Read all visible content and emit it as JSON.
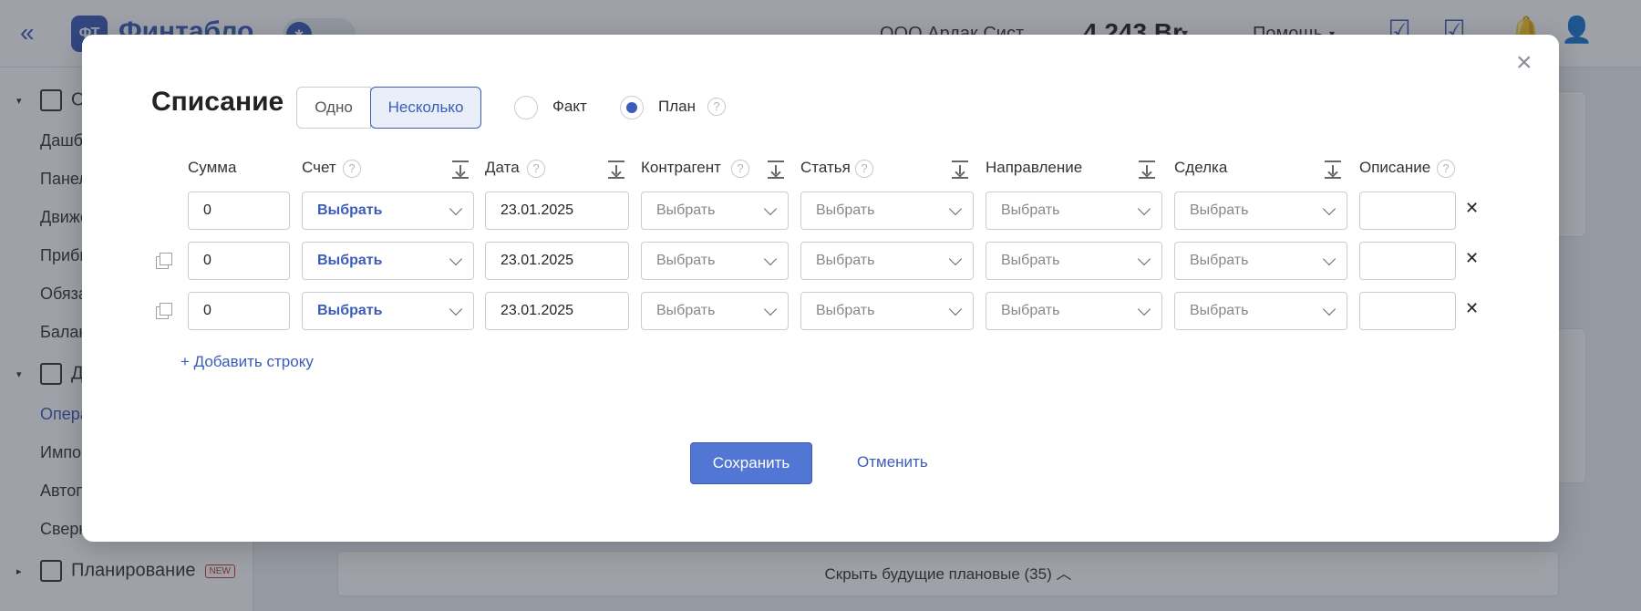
{
  "app": {
    "logo_text": "Финтабло",
    "logo_mark": "ФТ",
    "org_dot": "✱",
    "company": "ООО Ардак Сист",
    "balance": "4 243 Br",
    "help_label": "Помощь"
  },
  "sidebar": {
    "section_analytics": "Отчеты",
    "items_analytics": [
      "Дашборд",
      "Панель",
      "Движение",
      "Прибыль",
      "Обязательства",
      "Баланс"
    ],
    "section_money": "Деньги",
    "items_money": [
      "Операции",
      "Импорт",
      "Автоправила",
      "Сверка"
    ],
    "section_planning": "Планирование",
    "new_badge": "NEW"
  },
  "footer_bar": {
    "label": "Скрыть будущие плановые",
    "count": "(35)",
    "caret": "︿"
  },
  "modal": {
    "title": "Списание",
    "close_glyph": "×",
    "mode_one": "Одно",
    "mode_many": "Несколько",
    "mode_selected": "Несколько",
    "type_fact": "Факт",
    "type_plan": "План",
    "type_selected": "План",
    "help_glyph": "?",
    "columns": {
      "amount": "Сумма",
      "account": "Счет",
      "date": "Дата",
      "counterparty": "Контрагент",
      "category": "Статья",
      "direction": "Направление",
      "deal": "Сделка",
      "description": "Описание"
    },
    "rows": [
      {
        "amount": "0",
        "account": "Выбрать",
        "date": "23.01.2025",
        "counterparty": "Выбрать",
        "category": "Выбрать",
        "direction": "Выбрать",
        "deal": "Выбрать",
        "description": ""
      },
      {
        "amount": "0",
        "account": "Выбрать",
        "date": "23.01.2025",
        "counterparty": "Выбрать",
        "category": "Выбрать",
        "direction": "Выбрать",
        "deal": "Выбрать",
        "description": ""
      },
      {
        "amount": "0",
        "account": "Выбрать",
        "date": "23.01.2025",
        "counterparty": "Выбрать",
        "category": "Выбрать",
        "direction": "Выбрать",
        "deal": "Выбрать",
        "description": ""
      }
    ],
    "remove_glyph": "✕",
    "add_row": "+ Добавить строку",
    "save": "Сохранить",
    "cancel": "Отменить"
  },
  "colors": {
    "accent": "#3b5cb8",
    "save_button": "#5276d4",
    "overlay": "#282e3c"
  },
  "icons": [
    "double-chevron-left-icon",
    "checklist-icon",
    "notification-bell-icon",
    "user-icon",
    "help-circle-icon",
    "sort-down-icon",
    "copy-icon",
    "close-icon",
    "chevron-down-icon"
  ]
}
